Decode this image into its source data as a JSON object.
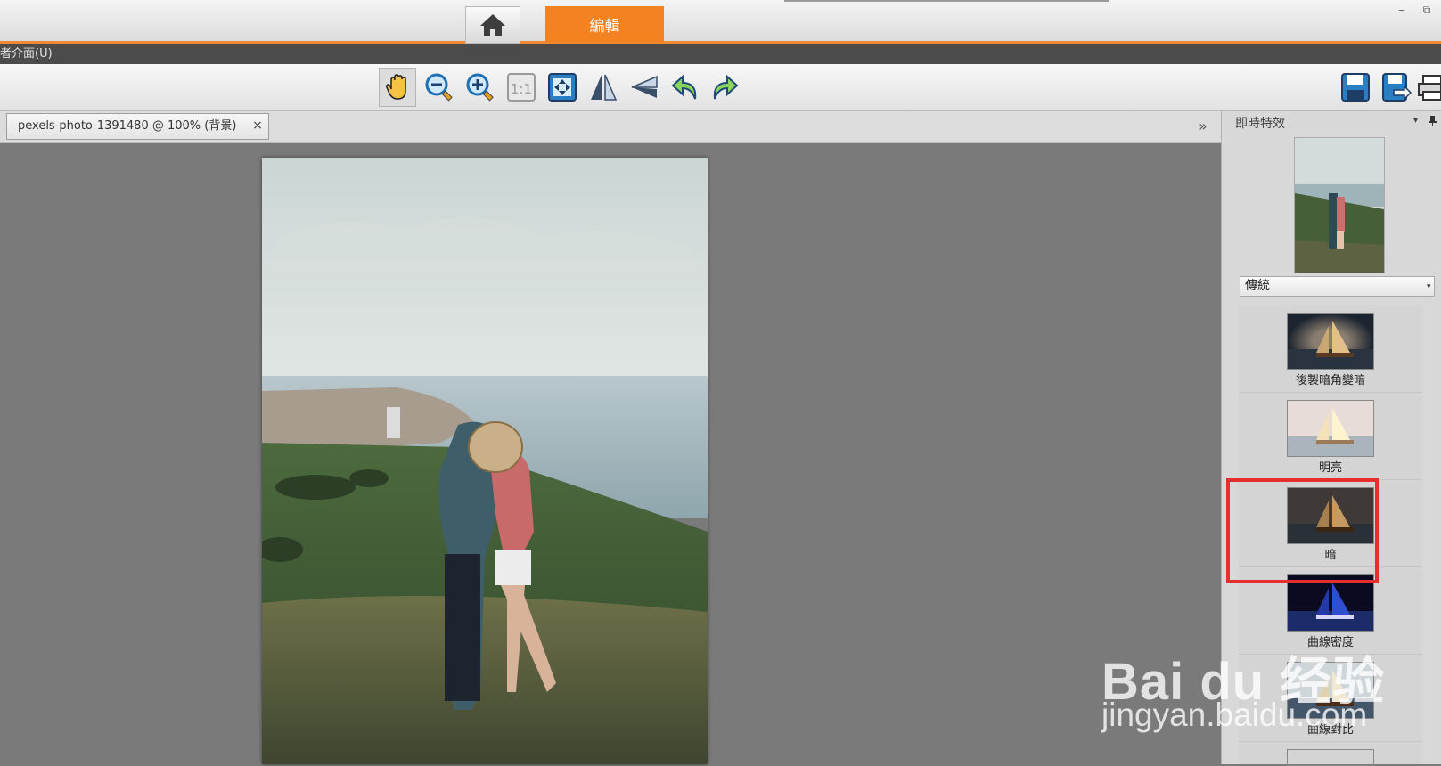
{
  "tabs": {
    "home_icon": "home-icon",
    "edit_label": "編輯"
  },
  "window_controls": {
    "minimize": "‒",
    "restore": "⧉"
  },
  "menu": {
    "text": "者介面(U)"
  },
  "toolbar": {
    "tools": [
      "hand-icon",
      "zoom-out-icon",
      "zoom-in-icon",
      "actual-size-icon",
      "fit-window-icon",
      "flip-horizontal-icon",
      "flip-vertical-icon",
      "rotate-left-icon",
      "rotate-right-icon"
    ],
    "right": [
      "save-icon",
      "save-as-icon",
      "print-icon"
    ],
    "actual_size_label": "1:1"
  },
  "document": {
    "tab_label": "pexels-photo-1391480 @ 100% (背景)",
    "close_symbol": "×",
    "scroll_symbol": "»"
  },
  "panel": {
    "title": "即時特效",
    "dropdown_arrow": "▾",
    "pin": "📌",
    "style_value": "傳統",
    "select_caret": "▾",
    "effects": [
      {
        "label": "後製暗角變暗",
        "tone": "vignette"
      },
      {
        "label": "明亮",
        "tone": "bright"
      },
      {
        "label": "暗",
        "tone": "dark"
      },
      {
        "label": "曲線密度",
        "tone": "curves-density"
      },
      {
        "label": "曲線對比",
        "tone": "curves-contrast"
      }
    ]
  },
  "watermark": {
    "main": "Bai du 经验",
    "sub": "jingyan.baidu.com"
  },
  "colors": {
    "accent": "#f58220",
    "highlight": "#e62e2e",
    "menu_bg": "#4b4b4b"
  }
}
